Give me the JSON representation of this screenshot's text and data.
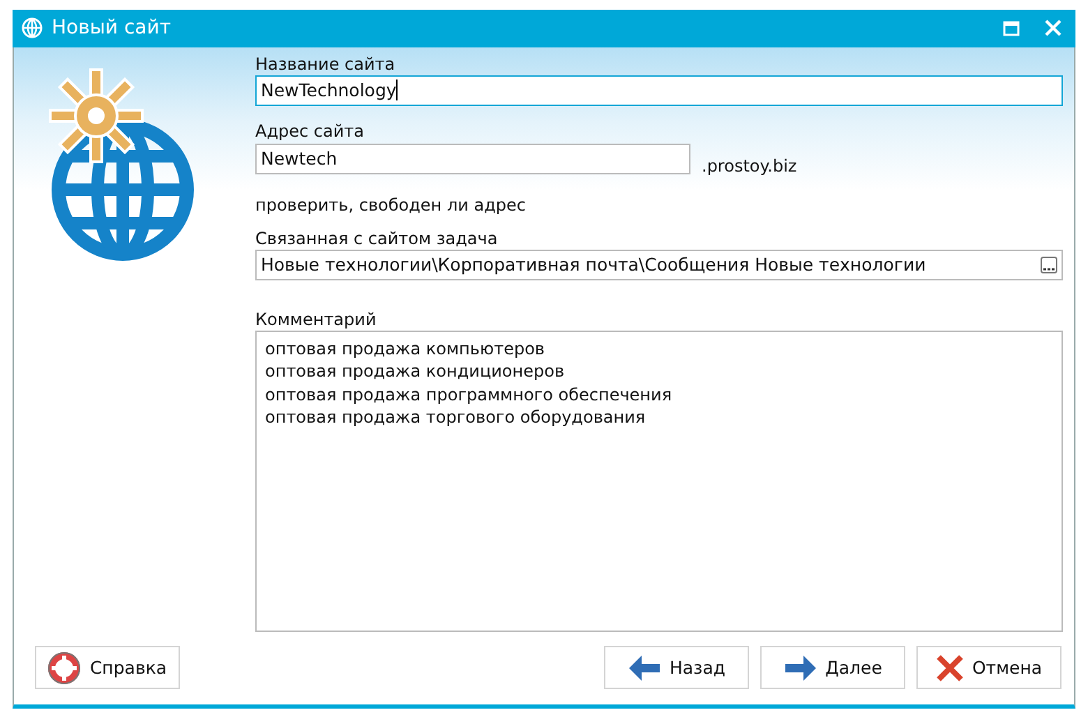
{
  "window": {
    "title": "Новый сайт"
  },
  "site_name": {
    "label": "Название сайта",
    "value": "NewTechnology",
    "focused": true
  },
  "site_address": {
    "label": "Адрес сайта",
    "value": "Newtech",
    "suffix": ".prostoy.biz"
  },
  "check_link": "проверить, свободен ли адрес",
  "related_task": {
    "label": "Связанная с сайтом задача",
    "value": "Новые технологии\\Корпоративная почта\\Сообщения Новые технологии"
  },
  "comment": {
    "label": "Комментарий",
    "lines": [
      "оптовая продажа компьютеров",
      "оптовая продажа кондиционеров",
      "оптовая продажа программного обеспечения",
      "оптовая продажа торгового оборудования"
    ]
  },
  "buttons": [
    {
      "kind": "help",
      "label": "Справка"
    },
    {
      "kind": "back",
      "label": "Назад"
    },
    {
      "kind": "next",
      "label": "Далее"
    },
    {
      "kind": "cancel",
      "label": "Отмена"
    }
  ]
}
